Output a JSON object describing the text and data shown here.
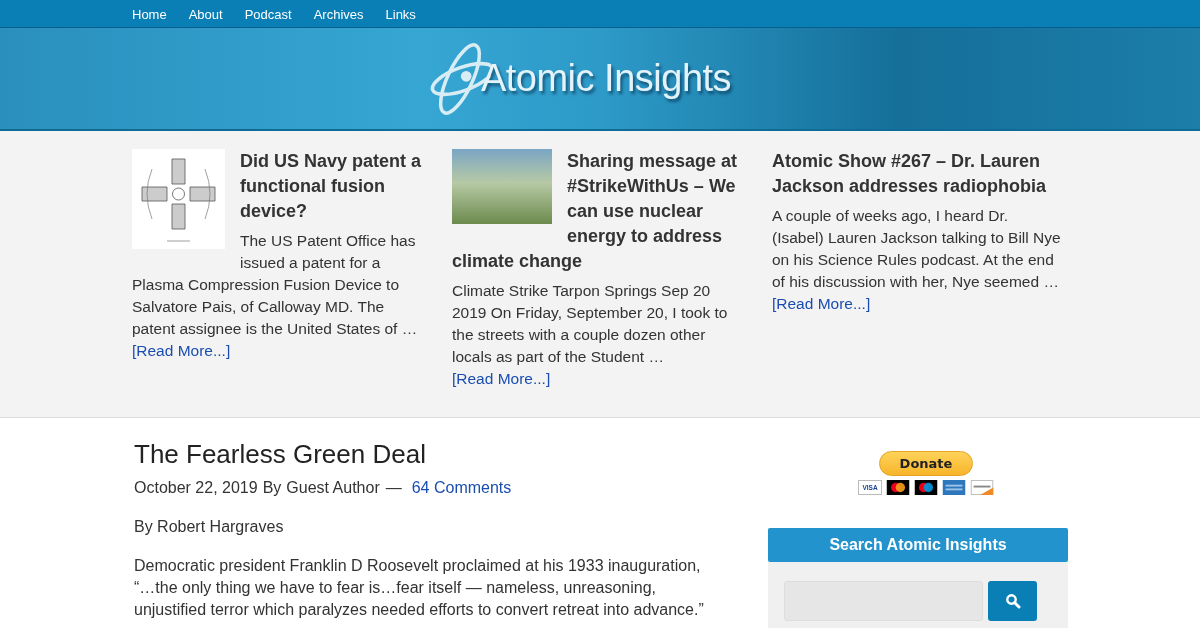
{
  "nav": {
    "items": [
      {
        "label": "Home"
      },
      {
        "label": "About"
      },
      {
        "label": "Podcast"
      },
      {
        "label": "Archives"
      },
      {
        "label": "Links"
      }
    ]
  },
  "header": {
    "logo_text": "Atomic Insights"
  },
  "featured": [
    {
      "kind": "patent",
      "title": "Did US Navy patent a functional fusion device?",
      "excerpt": "The US Patent Office has issued a patent for a Plasma Compression Fusion Device to Salvatore Pais, of Calloway MD. The patent assignee is the United States of …",
      "more": "[Read More...]"
    },
    {
      "kind": "photo",
      "title": "Sharing message at #StrikeWithUs – We can use nuclear energy to address climate change",
      "excerpt": "Climate Strike Tarpon Springs Sep 20 2019 On Friday, September 20, I took to the streets with a couple dozen other locals as part of the Student …",
      "more": "[Read More...]"
    },
    {
      "kind": "none",
      "title": "Atomic Show #267 – Dr. Lauren Jackson addresses radiophobia",
      "excerpt": "A couple of weeks ago, I heard Dr. (Isabel) Lauren Jackson talking to Bill Nye on his Science Rules podcast. At the end of his discussion with her, Nye seemed …",
      "more": "[Read More...]"
    }
  ],
  "post": {
    "title": "The Fearless Green Deal",
    "date": "October 22, 2019",
    "by": "By",
    "author": "Guest Author",
    "separator": "—",
    "comments": "64 Comments",
    "paragraphs": [
      "By Robert Hargraves",
      "Democratic president Franklin D Roosevelt proclaimed at his 1933 inauguration, “…the only thing we have to fear is…fear itself — nameless, unreasoning, unjustified terror which paralyzes needed efforts to convert retreat into advance.”"
    ]
  },
  "sidebar": {
    "donate": "Donate",
    "card_text": "VISA",
    "search_title": "Search Atomic Insights"
  }
}
